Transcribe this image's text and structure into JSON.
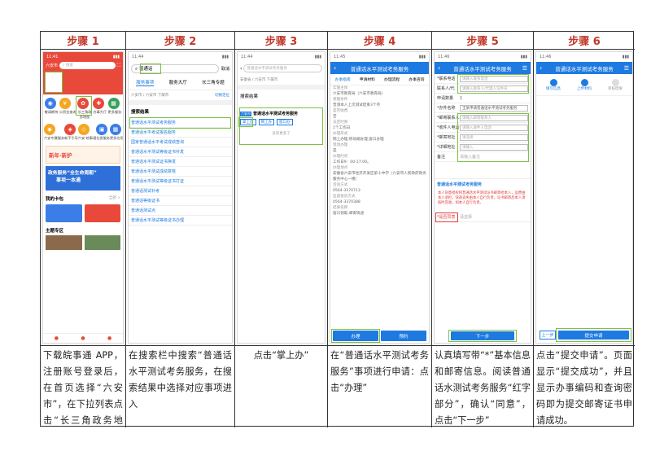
{
  "steps": [
    {
      "title": "步骤 1",
      "desc": "下载皖事通 APP，注册账号登录后，在首页选择“六安市”，在下拉列表点击“长三角政务地图”进入"
    },
    {
      "title": "步骤 2",
      "desc": "在搜索栏中搜索“普通话水平测试考务服务，在搜索结果中选择对应事项进入"
    },
    {
      "title": "步骤 3",
      "desc": "点击“掌上办”"
    },
    {
      "title": "步骤 4",
      "desc": "在“普通话水平测试考务服务”事项进行申请：点击“办理”"
    },
    {
      "title": "步骤 5",
      "desc": "认真填写带“*”基本信息和邮寄信息。阅读普通话水测试考务服务“红字部分”，确认“同意”，点击“下一步”"
    },
    {
      "title": "步骤 6",
      "desc": "点击“提交申请”。页面显示“提交成功”，并且显示办事编码和查询密码即为提交邮寄证书申请成功。"
    }
  ],
  "s1": {
    "city": "六安市",
    "search_placeholder": "搜索",
    "icons": [
      "敬请期待",
      "公积金查询",
      "长三角政务地图",
      "办事大厅",
      "更多服务"
    ],
    "icons2": [
      "六安专属服务",
      "新手引导",
      "六安·皖事通",
      "社保服务",
      "更多应用"
    ],
    "banner1": "新年·新护",
    "banner2": "政务服务“全生命周期”",
    "banner3": "事项一本通",
    "my_card": "我的卡包",
    "more": "全部 >",
    "topic": "主题专区"
  },
  "s2": {
    "search_value": "普通话",
    "search_btn": "取消",
    "tabs": [
      "服务事项",
      "服务大厅",
      "长三角专题"
    ],
    "location": "六安市 / 六安市 下属市",
    "filter": "切换定位",
    "section": "搜索结果",
    "results": [
      "普通话水平测试考务服务",
      "普通话水平考试报名服务",
      "国家普通话水平考试成绩查询",
      "普通话水平测试等级证书补发",
      "普通话水平测试证书换发",
      "普通话水平测试成绩复核",
      "普通话水平测试等级证书打证",
      "普通话测试补考",
      "普通话等级证书",
      "普通话测试点",
      "普通话水平测试等级证书办理"
    ]
  },
  "s3": {
    "search_value": "普通话水平测试考务服务",
    "location": "安徽省 / 六安市 下属市",
    "section": "搜索结果",
    "result_tag": "六安市",
    "result": "普通话水平测试考务服务",
    "buttons": [
      "掌上办",
      "网上办",
      "窗口办"
    ],
    "footer": "没有更多了"
  },
  "s4": {
    "title": "普通话水平测试考务服务",
    "tabs": [
      "办事指南",
      "申请材料",
      "办理流程",
      "办事咨询"
    ],
    "fields": [
      [
        "实施主体",
        "六安市教育局（六安市教育局）"
      ],
      [
        "受理条件",
        "普测本人上次测试结束3个月"
      ],
      [
        "是否收费",
        "否"
      ],
      [
        "法定时限",
        "1个工作日"
      ],
      [
        "办理形式",
        "网上办理,移动端办理,窗口办理"
      ],
      [
        "现场办理",
        "是"
      ],
      [
        "办理时间",
        "工作日9：00-17:00。"
      ],
      [
        "办理地点",
        "安徽省六安市经济开发区第十中学（六安市人民政府政务服务中心一楼）"
      ],
      [
        "咨询方式",
        "0564-3370713"
      ],
      [
        "监督投诉方式",
        "0564-3370388"
      ],
      [
        "结果名称",
        "窗口领取,邮寄快递"
      ]
    ],
    "btn_apply": "办理",
    "btn_book": "预约"
  },
  "s5": {
    "title": "普通话水平测试考务服务",
    "form": [
      [
        "*联系电话",
        "请输入联系电话"
      ],
      [
        "联系人/代",
        "请输入联系人/代理人证件号"
      ],
      [
        "申请数量",
        "1"
      ],
      [
        "*办件名称",
        "王某申请普通话水平测试考务服务"
      ],
      [
        "*邮寄联系人",
        "请输入邮寄联系人"
      ],
      [
        "*收件人电话",
        "请输入收件人电话"
      ],
      [
        "*邮寄地址",
        "请选择"
      ],
      [
        "*详细地址",
        "请输入"
      ],
      [
        "备注",
        "请输入备注"
      ]
    ],
    "notice_title": "普通话水平测试考务服务",
    "notice": "本人同意授权将普通话水平测试证书邮寄给本人，运费由本人承担，快递丢失由本人自行负责，证书邮寄后本人须按时签收，如本人自行负责。",
    "agree_label": "*是否同意",
    "agree_value": "请选择",
    "next": "下一步"
  },
  "s6": {
    "title": "普通话水平测试考务服务",
    "progress": [
      "填写信息",
      "上传材料",
      "审核结果"
    ],
    "prev": "上一步",
    "submit": "提交申请"
  }
}
